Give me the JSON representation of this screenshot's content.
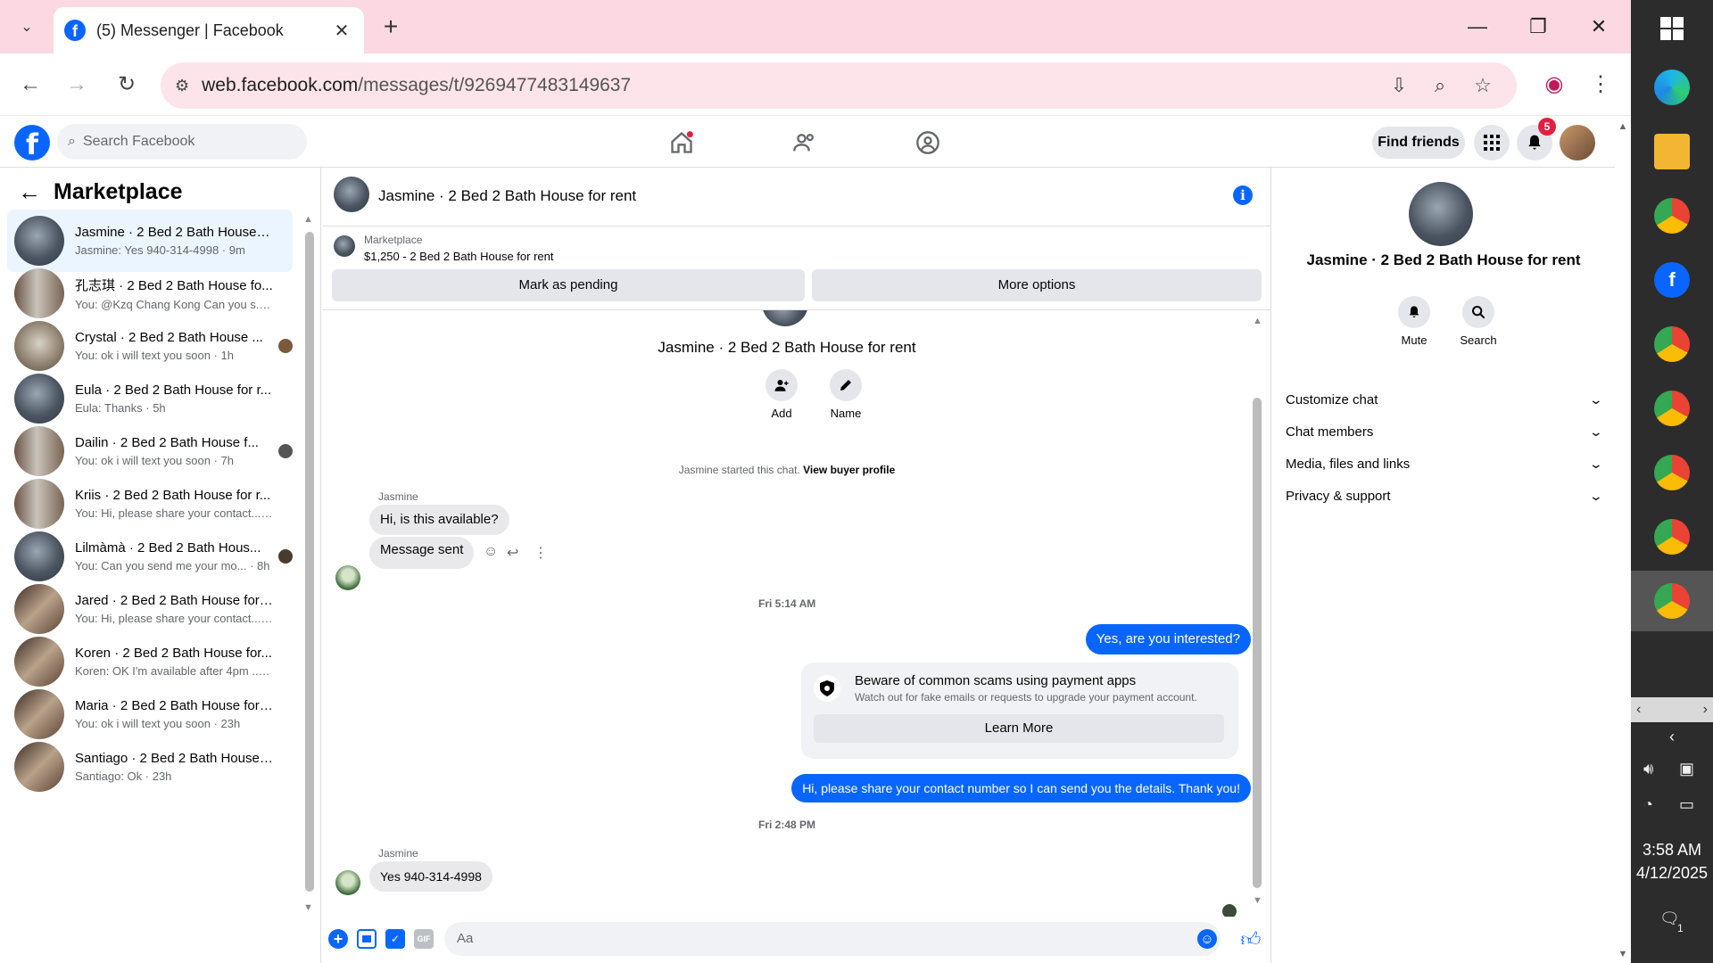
{
  "browser": {
    "tab_title": "(5) Messenger | Facebook",
    "tab_close": "✕",
    "new_tab": "+",
    "url_host": "web.facebook.com",
    "url_path": "/messages/t/9269477483149637"
  },
  "fb": {
    "search_placeholder": "Search Facebook",
    "find_friends": "Find friends",
    "notification_count": "5"
  },
  "sidebar": {
    "title": "Marketplace",
    "conversations": [
      {
        "name": "Jasmine · 2 Bed 2 Bath House f...",
        "preview": "Jasmine: Yes 940-314-4998 · 9m",
        "active": true
      },
      {
        "name": "孔志琪 · 2 Bed 2 Bath House fo...",
        "preview": "You: @Kzq Chang Kong Can you s... · 1h"
      },
      {
        "name": "Crystal · 2 Bed 2 Bath House ...",
        "preview": "You: ok i will text you soon · 1h"
      },
      {
        "name": "Eula · 2 Bed 2 Bath House for r...",
        "preview": "Eula: Thanks · 5h"
      },
      {
        "name": "Dailin · 2 Bed 2 Bath House f...",
        "preview": "You: ok i will text you soon · 7h"
      },
      {
        "name": "Kriis · 2 Bed 2 Bath House for r...",
        "preview": "You: Hi, please share your contact... · 7h"
      },
      {
        "name": "Lilmàmà · 2 Bed 2 Bath Hous...",
        "preview": "You: Can you send me your mo... · 8h"
      },
      {
        "name": "Jared · 2 Bed 2 Bath House for ...",
        "preview": "You: Hi, please share your contact... · 8h"
      },
      {
        "name": "Koren · 2 Bed 2 Bath House for...",
        "preview": "Koren: OK I'm available after 4pm ... · 9h"
      },
      {
        "name": "Maria · 2 Bed 2 Bath House for ...",
        "preview": "You: ok i will text you soon · 23h"
      },
      {
        "name": "Santiago · 2 Bed 2 Bath House ...",
        "preview": "Santiago: Ok · 23h"
      }
    ]
  },
  "chat": {
    "title": "Jasmine · 2 Bed 2 Bath House for rent",
    "marketplace_label": "Marketplace",
    "listing": "$1,250 - 2 Bed 2 Bath House for rent",
    "mark_pending": "Mark as pending",
    "more_options": "More options",
    "intro_title": "Jasmine · 2 Bed 2 Bath House for rent",
    "add_label": "Add",
    "name_label": "Name",
    "started_text": "Jasmine started this chat.",
    "view_profile": "View buyer profile",
    "sender_1": "Jasmine",
    "msg_1": "Hi, is this available?",
    "msg_2": "Message sent",
    "time_1": "Fri 5:14 AM",
    "msg_3": "Yes, are you interested?",
    "scam_title": "Beware of common scams using payment apps",
    "scam_sub": "Watch out for fake emails or requests to upgrade your payment account.",
    "learn_more": "Learn More",
    "msg_4": "Hi, please share your contact number so I can send you the details. Thank you!",
    "time_2": "Fri 2:48 PM",
    "sender_2": "Jasmine",
    "msg_5": "Yes 940-314-4998",
    "composer_placeholder": "Aa"
  },
  "details": {
    "name": "Jasmine · 2 Bed 2 Bath House for rent",
    "mute": "Mute",
    "search": "Search",
    "sections": [
      "Customize chat",
      "Chat members",
      "Media, files and links",
      "Privacy & support"
    ]
  },
  "taskbar": {
    "time": "3:58 AM",
    "date": "4/12/2025",
    "notifications": "1"
  },
  "colors": {
    "accent": "#0866ff",
    "tab_bar": "#fcd9e2",
    "outgoing_bubble": "#0866ff"
  }
}
